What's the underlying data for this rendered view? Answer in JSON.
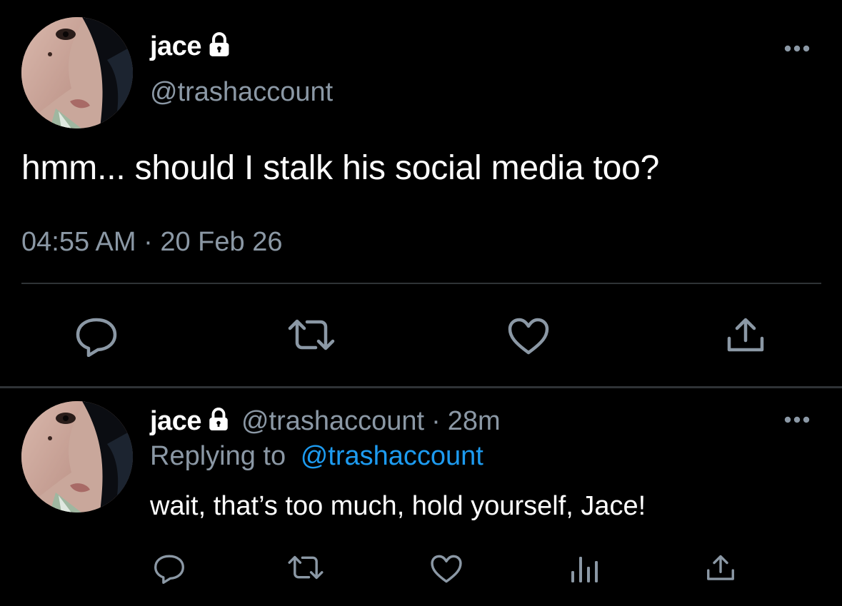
{
  "main_tweet": {
    "display_name": "jace",
    "handle": "@trashaccount",
    "text": "hmm... should I stalk his social media too?",
    "time": "04:55 AM",
    "separator": "·",
    "date": "20 Feb 26",
    "icons": {
      "lock": "lock-icon",
      "more": "more-horizontal-icon",
      "reply": "comment-icon",
      "retweet": "retweet-icon",
      "like": "heart-icon",
      "share": "share-icon"
    }
  },
  "reply_tweet": {
    "display_name": "jace",
    "handle": "@trashaccount",
    "separator": "·",
    "time_ago": "28m",
    "replying_prefix": "Replying to",
    "replying_handle": "@trashaccount",
    "text": "wait, that’s too much, hold yourself, Jace!",
    "icons": {
      "lock": "lock-icon",
      "more": "more-horizontal-icon",
      "reply": "comment-icon",
      "retweet": "retweet-icon",
      "like": "heart-icon",
      "views": "analytics-icon",
      "share": "share-icon"
    }
  },
  "colors": {
    "background": "#000000",
    "text_primary": "#ffffff",
    "text_secondary": "#8b98a5",
    "link": "#1d9bf0",
    "divider": "#2f3336"
  }
}
